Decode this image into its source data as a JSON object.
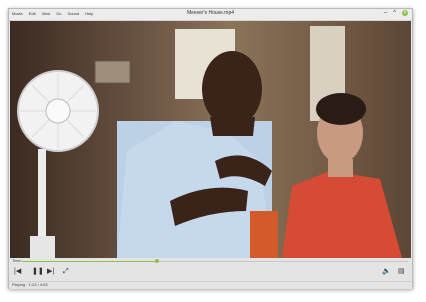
{
  "menu": [
    "Movie",
    "Edit",
    "View",
    "Go",
    "Sound",
    "Help"
  ],
  "window": {
    "title": "Meeser's House.mp4"
  },
  "video": {
    "content": "Movie frame: person with electric fan, two men talking"
  },
  "playback": {
    "time_label": "Time:",
    "progress": 0.35
  },
  "controls": {
    "prev_icon": "skip-back-icon",
    "pause_icon": "pause-icon",
    "next_icon": "skip-forward-icon",
    "fullscreen_icon": "fullscreen-icon",
    "volume_icon": "volume-icon",
    "sidebar_icon": "sidebar-icon"
  },
  "status": {
    "text": "Playing · 1:23 / 4:03"
  },
  "colors": {
    "accent": "#8bc34a"
  }
}
